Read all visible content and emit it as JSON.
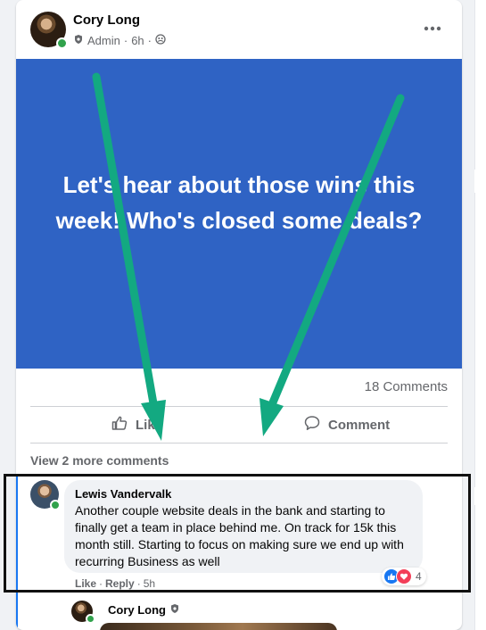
{
  "post": {
    "author_name": "Cory Long",
    "role": "Admin",
    "separator": "·",
    "time": "6h",
    "more_icon": "more-horizontal-icon",
    "banner_text": "Let's hear about those wins this week! Who's closed some deals?",
    "banner_color": "#2f63c4",
    "comments_count": "18 Comments",
    "actions": {
      "like": "Like",
      "comment": "Comment"
    }
  },
  "comments": {
    "view_more": "View 2 more comments",
    "first": {
      "author_name": "Lewis Vandervalk",
      "text": "Another couple website deals in the bank and starting to finally get a team in place behind me. On track for 15k this month still. Starting to focus on making sure we end up with recurring Business as well",
      "like": "Like",
      "dot": "·",
      "reply": "Reply",
      "time": "5h",
      "reaction_count": "4"
    },
    "reply": {
      "author_name": "Cory Long"
    }
  },
  "annotation": {
    "arrow_color": "#13a981",
    "box_color": "#111111"
  }
}
